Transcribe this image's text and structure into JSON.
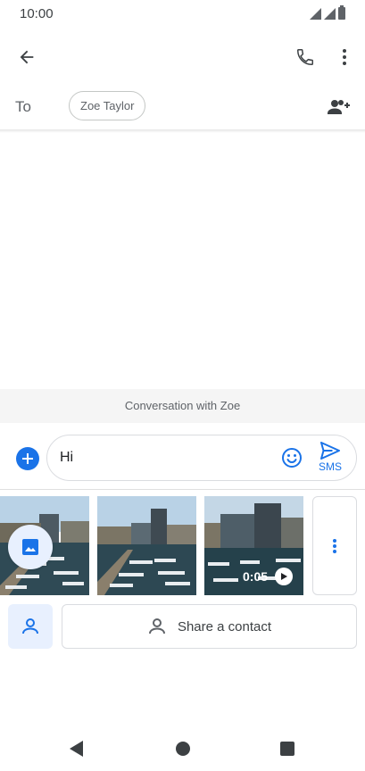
{
  "status_bar": {
    "time": "10:00"
  },
  "recipients": {
    "to_label": "To",
    "chips": [
      {
        "name": "Zoe Taylor"
      }
    ]
  },
  "conversation": {
    "banner": "Conversation with Zoe"
  },
  "compose": {
    "message_text": "Hi",
    "send_label": "SMS"
  },
  "media": {
    "video_duration": "0:05"
  },
  "contact": {
    "share_label": "Share a contact"
  },
  "icons": {
    "back": "arrow-back-icon",
    "call": "phone-icon",
    "more": "more-vert-icon",
    "add_people": "add-people-icon",
    "add": "plus-icon",
    "emoji": "emoji-icon",
    "send": "send-icon",
    "gallery": "image-icon",
    "play": "play-icon",
    "contact": "person-icon"
  },
  "colors": {
    "accent": "#1a73e8",
    "accent_light": "#e8f0fe"
  }
}
